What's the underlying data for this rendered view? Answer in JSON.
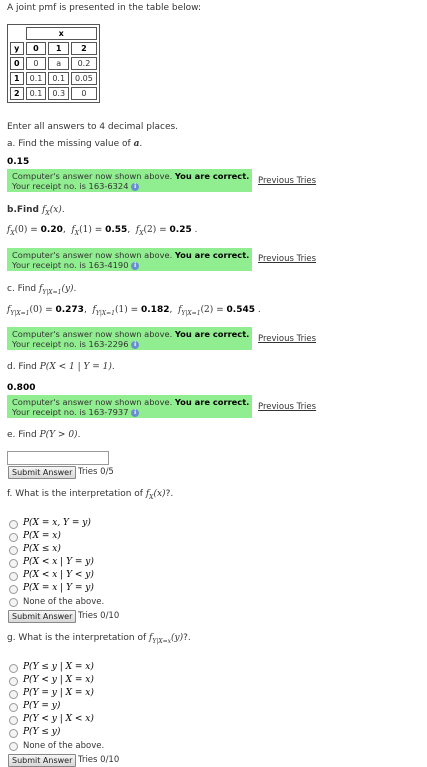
{
  "intro": "A joint pmf is presented in the table below:",
  "table": {
    "x_header": "x",
    "y_header": "y",
    "x_values": [
      "0",
      "1",
      "2"
    ],
    "rows": [
      {
        "y": "0",
        "cells": [
          "0",
          "a",
          "0.2"
        ]
      },
      {
        "y": "1",
        "cells": [
          "0.1",
          "0.1",
          "0.05"
        ]
      },
      {
        "y": "2",
        "cells": [
          "0.1",
          "0.3",
          "0"
        ]
      }
    ]
  },
  "instructions": "Enter all answers to 4 decimal places.",
  "correct_msg": {
    "prefix": "Computer's answer now shown above. ",
    "bold": "You are correct.",
    "receipt_prefix": "Your receipt no. is "
  },
  "previous_tries": "Previous Tries",
  "info_icon": "info-icon",
  "qa": {
    "label": "a. Find the missing value of ",
    "var": "a",
    "end": ".",
    "answer": "0.15",
    "receipt": "163-6324"
  },
  "qb": {
    "label": "b.Find ",
    "func": "f",
    "sub": "X",
    "arg": "(x)",
    "end": ".",
    "vals": [
      {
        "arg": "(0)",
        "val": "0.20"
      },
      {
        "arg": "(1)",
        "val": "0.55"
      },
      {
        "arg": "(2)",
        "val": "0.25"
      }
    ],
    "receipt": "163-4190"
  },
  "qc": {
    "label": "c. Find ",
    "sub": "Y|X=1",
    "arg": "(y)",
    "end": ".",
    "vals": [
      {
        "arg": "(0)",
        "val": "0.273"
      },
      {
        "arg": "(1)",
        "val": "0.182"
      },
      {
        "arg": "(2)",
        "val": "0.545"
      }
    ],
    "receipt": "163-2296"
  },
  "qd": {
    "label": "d. Find ",
    "expr": "P(X < 1 | Y = 1)",
    "end": ".",
    "answer": "0.800",
    "receipt": "163-7937"
  },
  "qe": {
    "label": "e. Find ",
    "expr": "P(Y > 0)",
    "end": ".",
    "input_value": "",
    "submit": "Submit Answer",
    "tries": "Tries 0/5"
  },
  "qf": {
    "label": "f. What is the interpretation of ",
    "func": "f",
    "sub": "X",
    "arg": "(x)",
    "end": "?.",
    "options": [
      "P(X = x, Y = y)",
      "P(X = x)",
      "P(X ≤ x)",
      "P(X < x | Y = y)",
      "P(X < x | Y < y)",
      "P(X = x | Y = y)",
      "None of the above."
    ],
    "submit": "Submit Answer",
    "tries": "Tries 0/10"
  },
  "qg": {
    "label": "g. What is the interpretation of ",
    "func": "f",
    "sub": "Y|X=x",
    "arg": "(y)",
    "end": "?.",
    "options": [
      "P(Y ≤ y | X = x)",
      "P(Y < y | X = x)",
      "P(Y = y | X = x)",
      "P(Y = y)",
      "P(Y < y | X < x)",
      "P(Y ≤ y)",
      "None of the above."
    ],
    "submit": "Submit Answer",
    "tries": "Tries 0/10"
  }
}
